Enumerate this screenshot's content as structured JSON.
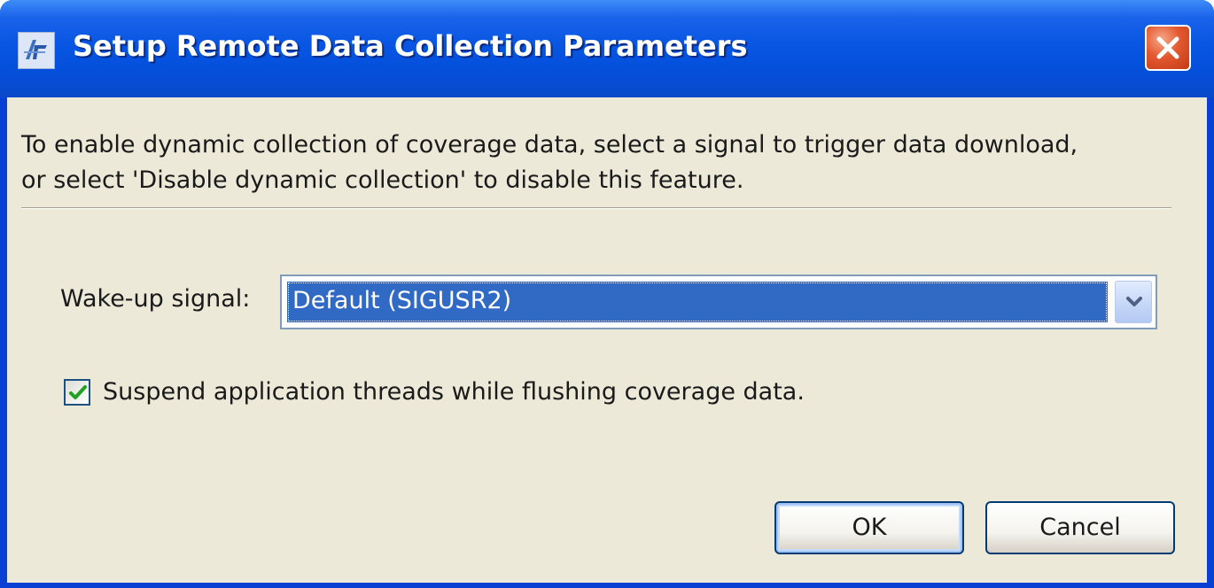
{
  "window": {
    "title": "Setup Remote Data Collection Parameters",
    "app_icon": "app-logo-icon",
    "close_icon": "close-icon"
  },
  "description": {
    "line1": "To enable dynamic collection of coverage data, select a signal to trigger data download,",
    "line2": "or select 'Disable dynamic collection' to disable this feature."
  },
  "wake_up": {
    "label": "Wake-up signal:",
    "selected": "Default (SIGUSR2)",
    "arrow_icon": "chevron-down-icon"
  },
  "suspend_option": {
    "label": "Suspend application threads while flushing coverage data.",
    "checked": true
  },
  "buttons": {
    "ok": "OK",
    "cancel": "Cancel"
  },
  "colors": {
    "titlebar": "#0856e3",
    "client_background": "#ece9d8",
    "selection": "#316ac5",
    "check_mark": "#21a121",
    "close_button": "#e3582f"
  }
}
